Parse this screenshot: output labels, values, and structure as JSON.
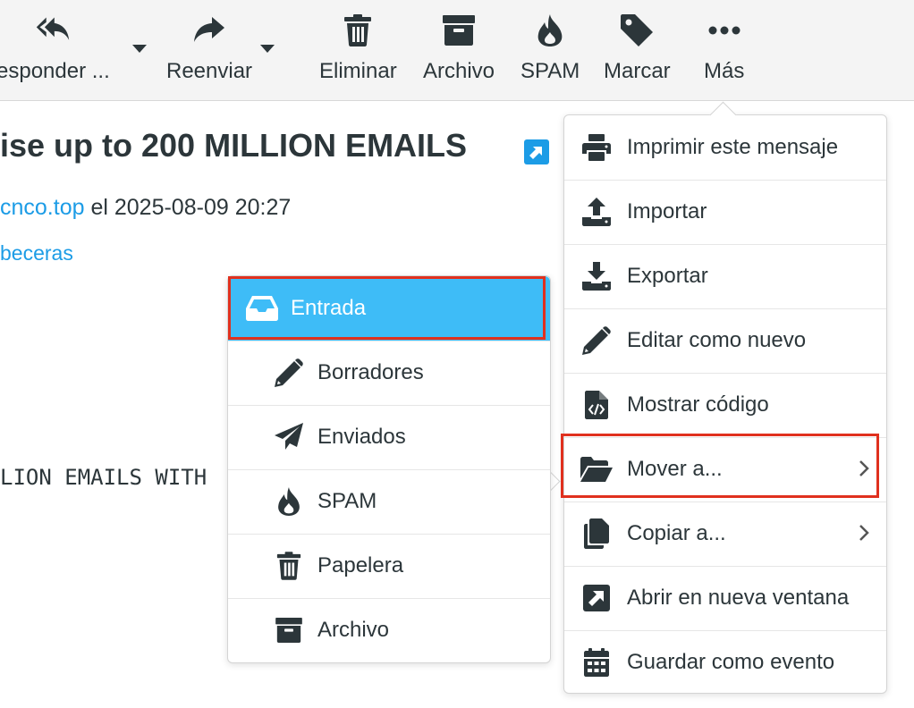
{
  "toolbar": {
    "reply_label": "esponder ...",
    "forward_label": "Reenviar",
    "delete_label": "Eliminar",
    "archive_label": "Archivo",
    "spam_label": "SPAM",
    "mark_label": "Marcar",
    "more_label": "Más"
  },
  "message": {
    "subject": "ise up to 200 MILLION EMAILS",
    "from_address": "cnco.top",
    "from_date": " el 2025-08-09 20:27",
    "headers_link": "beceras",
    "body_snippet": "LION EMAILS WITH"
  },
  "more_menu": {
    "items": [
      {
        "label": "Imprimir este mensaje",
        "icon": "printer-icon"
      },
      {
        "label": "Importar",
        "icon": "upload-icon"
      },
      {
        "label": "Exportar",
        "icon": "download-icon"
      },
      {
        "label": "Editar como nuevo",
        "icon": "pencil-icon"
      },
      {
        "label": "Mostrar código",
        "icon": "file-code-icon"
      },
      {
        "label": "Mover a...",
        "icon": "folder-open-icon",
        "submenu": true
      },
      {
        "label": "Copiar a...",
        "icon": "copy-icon",
        "submenu": true
      },
      {
        "label": "Abrir en nueva ventana",
        "icon": "external-link-icon"
      },
      {
        "label": "Guardar como evento",
        "icon": "calendar-icon"
      }
    ]
  },
  "folder_menu": {
    "items": [
      {
        "label": "Entrada",
        "icon": "inbox-icon",
        "active": true
      },
      {
        "label": "Borradores",
        "icon": "pencil-icon"
      },
      {
        "label": "Enviados",
        "icon": "paper-plane-icon"
      },
      {
        "label": "SPAM",
        "icon": "fire-icon"
      },
      {
        "label": "Papelera",
        "icon": "trash-icon"
      },
      {
        "label": "Archivo",
        "icon": "archive-icon"
      }
    ]
  },
  "colors": {
    "link": "#1c9ce6",
    "active_item": "#3ebcf7",
    "highlight_box": "#e0301e",
    "text": "#2c363a"
  }
}
